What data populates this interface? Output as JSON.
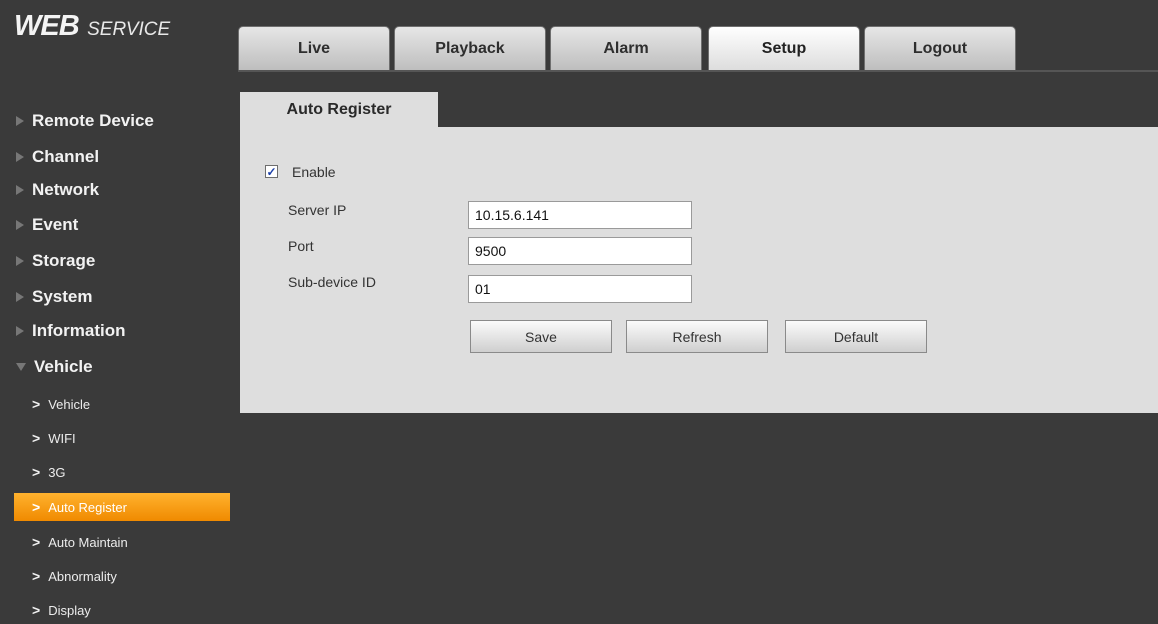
{
  "header": {
    "logo_main": "WEB",
    "logo_sub": "SERVICE",
    "tabs": [
      {
        "label": "Live",
        "active": false
      },
      {
        "label": "Playback",
        "active": false
      },
      {
        "label": "Alarm",
        "active": false
      },
      {
        "label": "Setup",
        "active": true
      },
      {
        "label": "Logout",
        "active": false
      }
    ]
  },
  "sidebar": {
    "categories": [
      {
        "label": "Remote Device",
        "expanded": false
      },
      {
        "label": "Channel",
        "expanded": false
      },
      {
        "label": "Network",
        "expanded": false
      },
      {
        "label": "Event",
        "expanded": false
      },
      {
        "label": "Storage",
        "expanded": false
      },
      {
        "label": "System",
        "expanded": false
      },
      {
        "label": "Information",
        "expanded": false
      },
      {
        "label": "Vehicle",
        "expanded": true
      }
    ],
    "subitems": [
      {
        "label": "Vehicle",
        "active": false
      },
      {
        "label": "WIFI",
        "active": false
      },
      {
        "label": "3G",
        "active": false
      },
      {
        "label": "Auto Register",
        "active": true
      },
      {
        "label": "Auto Maintain",
        "active": false
      },
      {
        "label": "Abnormality",
        "active": false
      },
      {
        "label": "Display",
        "active": false
      }
    ],
    "chevron": ">",
    "active_color": "#f59a0c"
  },
  "panel": {
    "tab_title": "Auto Register",
    "enable_label": "Enable",
    "enable_checked": true,
    "server_ip_label": "Server IP",
    "server_ip_value": "10.15.6.141",
    "port_label": "Port",
    "port_value": "9500",
    "subdevice_label": "Sub-device ID",
    "subdevice_value": "01",
    "save_label": "Save",
    "refresh_label": "Refresh",
    "default_label": "Default"
  }
}
